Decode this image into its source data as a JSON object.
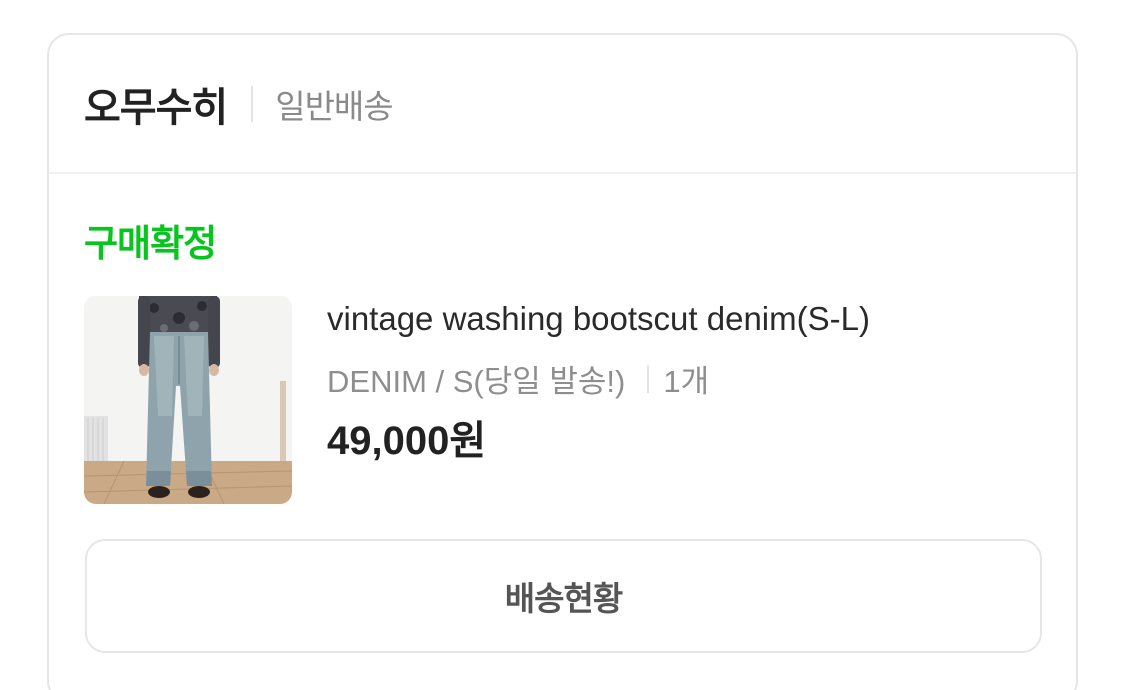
{
  "order": {
    "store_name": "오무수히",
    "delivery_type": "일반배송",
    "status": "구매확정",
    "status_color": "#08c41f",
    "product": {
      "name": "vintage washing bootscut denim(S-L)",
      "option": "DENIM / S(당일 발송!)",
      "quantity": "1개",
      "price": "49,000원",
      "image_icon": "product-photo-denim-jeans"
    },
    "track_button_label": "배송현황"
  }
}
